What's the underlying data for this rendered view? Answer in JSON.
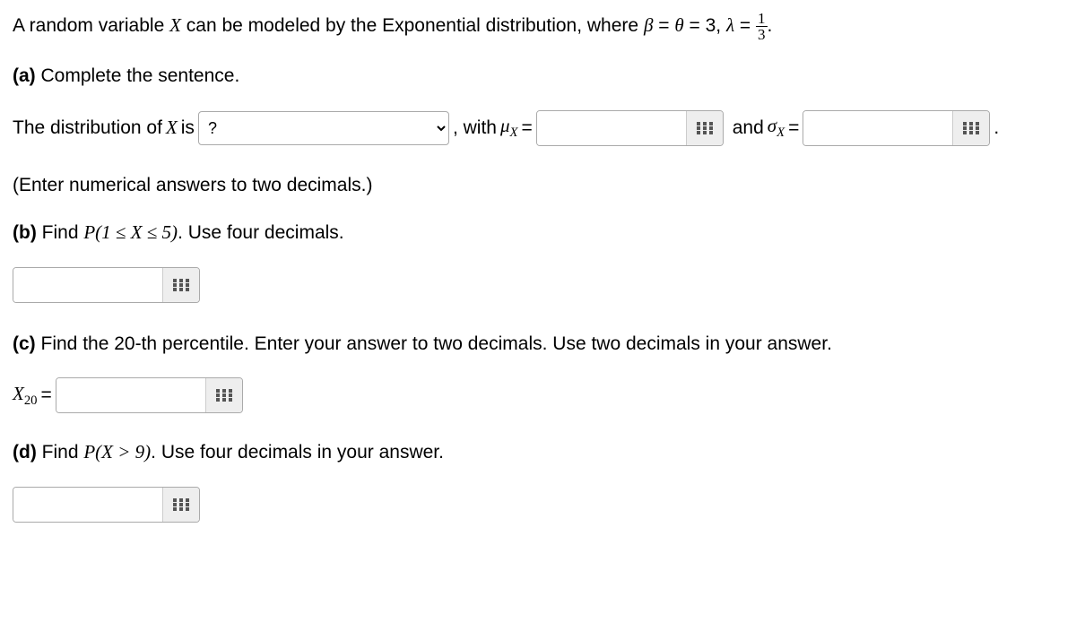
{
  "intro": {
    "pre": "A random variable ",
    "X": "X",
    "mid": " can be modeled by the Exponential distribution, where ",
    "param_beta": "β",
    "eq1": " = ",
    "param_theta": "θ",
    "eq2": " = 3, ",
    "param_lambda": "λ",
    "eq3": " = ",
    "frac_num": "1",
    "frac_den": "3",
    "end": "."
  },
  "a": {
    "label": "(a)",
    "text": " Complete the sentence.",
    "sent_pre": "The distribution of ",
    "X": "X",
    "sent_is": " is ",
    "select_placeholder": "?",
    "with": ", with ",
    "mu": "μ",
    "sub": "X",
    "eq": " = ",
    "and": " and ",
    "sigma": "σ",
    "period": ".",
    "note": "(Enter numerical answers to two decimals.)"
  },
  "b": {
    "label": "(b)",
    "pre": " Find ",
    "expr": "P(1 ≤ X ≤ 5)",
    "post": ". Use four decimals."
  },
  "c": {
    "label": "(c)",
    "text": " Find the 20-th percentile. Enter your answer to two decimals. Use two decimals in your answer.",
    "Xlab": "X",
    "sub": "20",
    "eq": " = "
  },
  "d": {
    "label": "(d)",
    "pre": " Find ",
    "expr": "P(X > 9)",
    "post": ". Use four decimals in your answer."
  }
}
